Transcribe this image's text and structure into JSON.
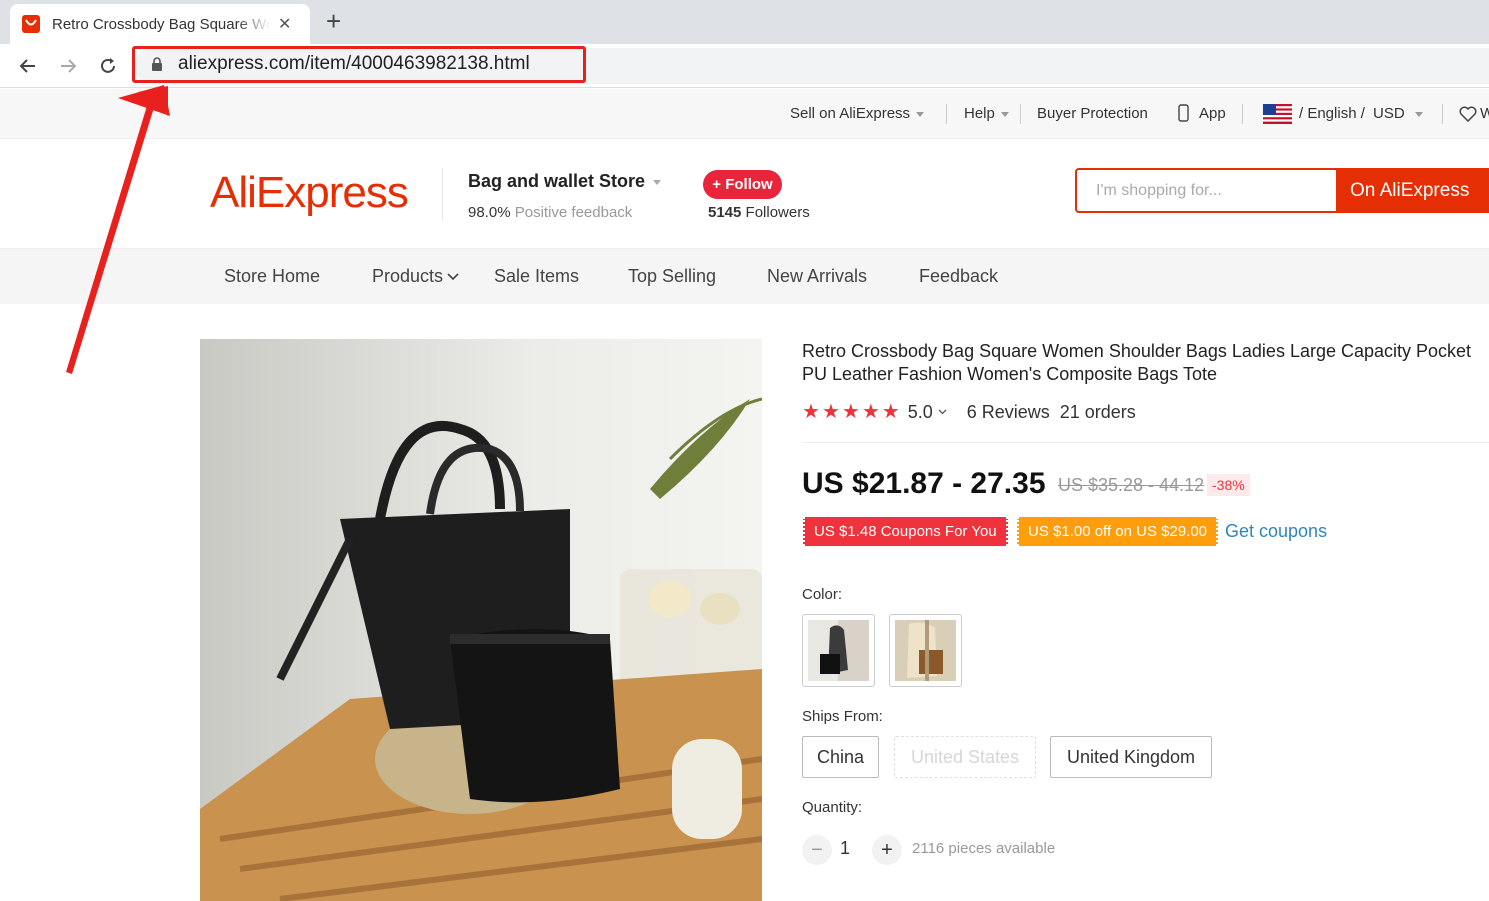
{
  "browser": {
    "tab_title": "Retro Crossbody Bag Square Women Shoulder Bags",
    "tab_close": "✕",
    "new_tab": "+",
    "url": "aliexpress.com/item/4000463982138.html"
  },
  "topbar": {
    "sell": "Sell on AliExpress",
    "help": "Help",
    "buyer_protection": "Buyer Protection",
    "app": "App",
    "language": "/ English /",
    "currency": "USD",
    "wishlist": "W"
  },
  "header": {
    "logo": "AliExpress",
    "store_name": "Bag and wallet Store",
    "feedback_value": "98.0%",
    "feedback_label": "Positive feedback",
    "follow_label": "+ Follow",
    "followers_count": "5145",
    "followers_label": "Followers",
    "search_placeholder": "I'm shopping for...",
    "search_button": "On AliExpress"
  },
  "store_nav": {
    "items": [
      "Store Home",
      "Products",
      "Sale Items",
      "Top Selling",
      "New Arrivals",
      "Feedback"
    ]
  },
  "product": {
    "title": "Retro Crossbody Bag Square Women Shoulder Bags Ladies Large Capacity Pocket PU Leather Fashion Women's Composite Bags Tote",
    "rating": "5.0",
    "stars": 5,
    "reviews": "6 Reviews",
    "orders": "21 orders",
    "price": "US $21.87 - 27.35",
    "old_price": "US $35.28 - 44.12",
    "discount": "-38%",
    "coupon1": "US $1.48 Coupons For You",
    "coupon2": "US $1.00 off on US $29.00",
    "get_coupons": "Get coupons",
    "color_label": "Color:",
    "ships_from_label": "Ships From:",
    "ships_from": [
      "China",
      "United States",
      "United Kingdom"
    ],
    "quantity_label": "Quantity:",
    "quantity": "1",
    "qty_minus": "−",
    "qty_plus": "+",
    "available": "2116 pieces available"
  },
  "colors": {
    "brand": "#e62e04",
    "star": "#f0323c",
    "coupon_red": "#f0323c",
    "coupon_orange": "#ff9e0d",
    "link": "#2e86c1",
    "annotation": "#e8211f"
  }
}
